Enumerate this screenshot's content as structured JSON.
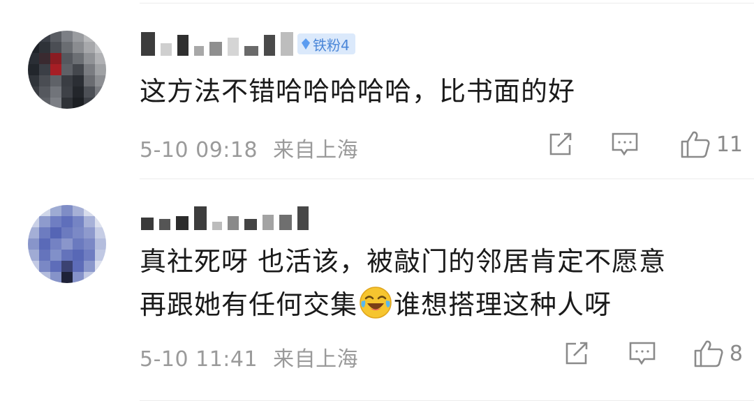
{
  "comments": [
    {
      "badge": "铁粉4",
      "text": "这方法不错哈哈哈哈哈，比书面的好",
      "time": "5-10 09:18",
      "location": "来自上海",
      "likes": "11"
    },
    {
      "text_before_emoji": "真社死呀 也活该，被敲门的邻居肯定不愿意\n再跟她有任何交集",
      "emoji_icon": "laughing-crying-emoji",
      "text_after_emoji": "谁想搭理这种人呀",
      "time": "5-10 11:41",
      "location": "来自上海",
      "likes": "8"
    }
  ]
}
